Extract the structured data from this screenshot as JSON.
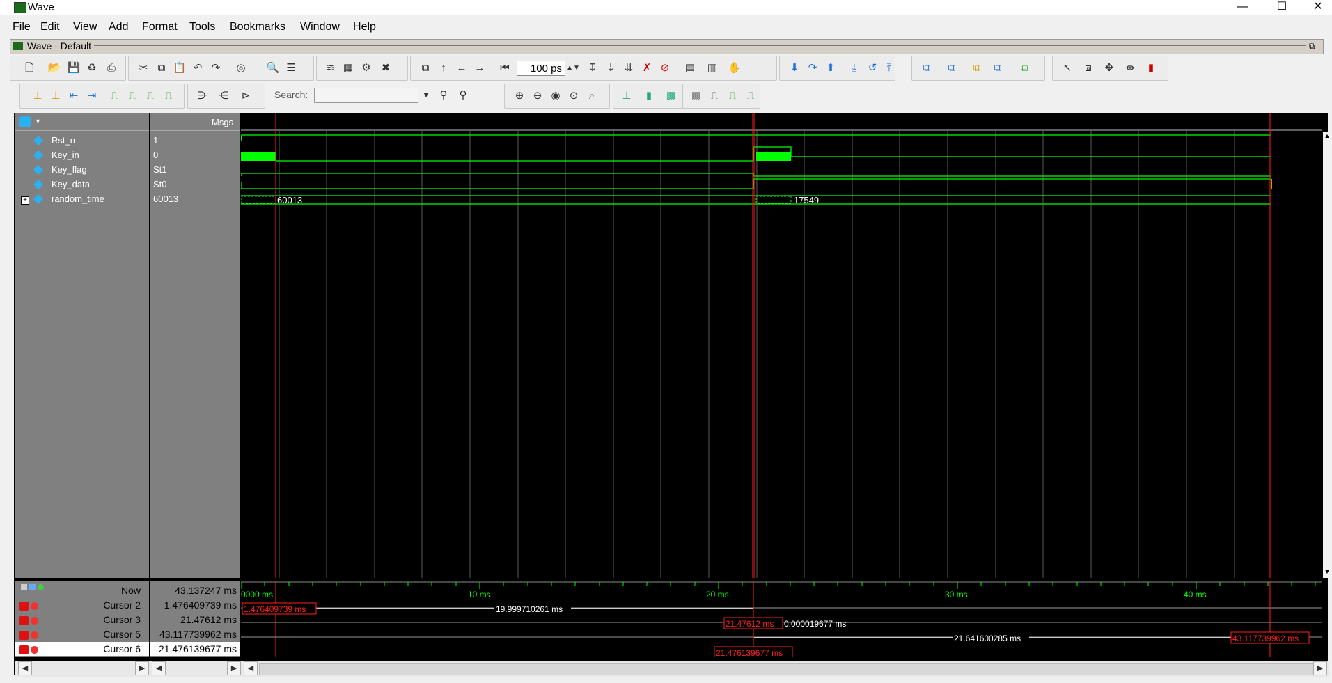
{
  "window": {
    "title": "Wave",
    "minimize": "—",
    "maximize": "☐",
    "close": "✕"
  },
  "menu": [
    "File",
    "Edit",
    "View",
    "Add",
    "Format",
    "Tools",
    "Bookmarks",
    "Window",
    "Help"
  ],
  "wave_window": {
    "title": "Wave - Default"
  },
  "toolbar": {
    "zoom_value": "100 ps",
    "search_label": "Search:",
    "search_value": ""
  },
  "header": {
    "msgs": "Msgs"
  },
  "signals": [
    {
      "name": "Rst_n",
      "value": "1"
    },
    {
      "name": "Key_in",
      "value": "0"
    },
    {
      "name": "Key_flag",
      "value": "St1"
    },
    {
      "name": "Key_data",
      "value": "St0"
    },
    {
      "name": "random_time",
      "value": "60013",
      "expand": "+"
    }
  ],
  "bus_labels": {
    "first": "60013",
    "second": "17549"
  },
  "timeline": {
    "ticks": [
      "0000 ms",
      "10 ms",
      "20 ms",
      "30 ms",
      "40 ms"
    ]
  },
  "now": {
    "label": "Now",
    "value": "43.137247 ms"
  },
  "cursors": [
    {
      "name": "Cursor 2",
      "value": "1.476409739 ms"
    },
    {
      "name": "Cursor 3",
      "value": "21.47612 ms"
    },
    {
      "name": "Cursor 5",
      "value": "43.117739962 ms"
    },
    {
      "name": "Cursor 6",
      "value": "21.476139677 ms"
    }
  ],
  "cursor_annotations": {
    "c2_box": "1.476409739 ms",
    "c2_to_c3": "19.999710261 ms",
    "c3_box": "21.47612 ms",
    "c3_to_c6": "0.000019677 ms",
    "c6_to_c5": "21.641600285 ms",
    "c5_box": "43.117739962 ms",
    "c6_box": "21.476139677 ms"
  },
  "colors": {
    "wave": "#00ff00",
    "cursor": "#ff2020",
    "bg": "#000000",
    "panel": "#808080"
  }
}
